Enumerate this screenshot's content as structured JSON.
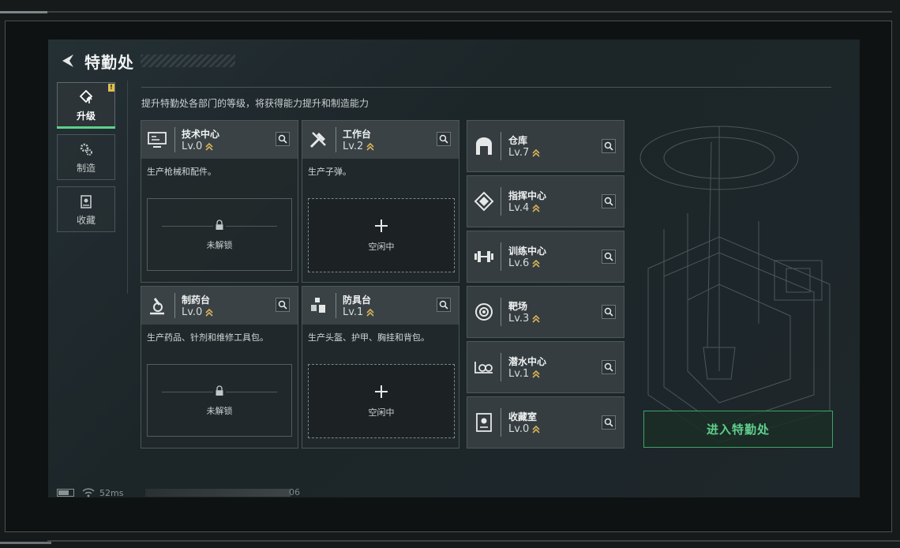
{
  "header": {
    "title": "特勤处"
  },
  "side_tabs": [
    {
      "label": "升级",
      "icon": "upgrade-icon",
      "active": true,
      "badge": "!"
    },
    {
      "label": "制造",
      "icon": "gears-icon",
      "active": false
    },
    {
      "label": "收藏",
      "icon": "collection-icon",
      "active": false
    }
  ],
  "subtitle": "提升特勤处各部门的等级，将获得能力提升和制造能力",
  "departments": [
    {
      "name": "技术中心",
      "level": "Lv.0",
      "description": "生产枪械和配件。",
      "slot_status": "未解锁",
      "icon": "computer-icon"
    },
    {
      "name": "工作台",
      "level": "Lv.2",
      "description": "生产子弹。",
      "slot_status": "空闲中",
      "icon": "tools-icon"
    },
    {
      "name": "制药台",
      "level": "Lv.0",
      "description": "生产药品、针剂和维修工具包。",
      "slot_status": "未解锁",
      "icon": "microscope-icon"
    },
    {
      "name": "防具台",
      "level": "Lv.1",
      "description": "生产头盔、护甲、胸挂和背包。",
      "slot_status": "空闲中",
      "icon": "armor-icon"
    }
  ],
  "facilities": [
    {
      "name": "仓库",
      "level": "Lv.7",
      "icon": "warehouse-icon"
    },
    {
      "name": "指挥中心",
      "level": "Lv.4",
      "icon": "command-icon"
    },
    {
      "name": "训练中心",
      "level": "Lv.6",
      "icon": "dumbbell-icon"
    },
    {
      "name": "靶场",
      "level": "Lv.3",
      "icon": "target-icon"
    },
    {
      "name": "潜水中心",
      "level": "Lv.1",
      "icon": "diving-icon"
    },
    {
      "name": "收藏室",
      "level": "Lv.0",
      "icon": "trophy-room-icon"
    }
  ],
  "enter_button": "进入特勤处",
  "status": {
    "ping": "52ms",
    "counter": "06"
  },
  "colors": {
    "accent_green": "#5fcf8c",
    "level_chevron": "#d9b25a",
    "badge": "#e0c050"
  }
}
